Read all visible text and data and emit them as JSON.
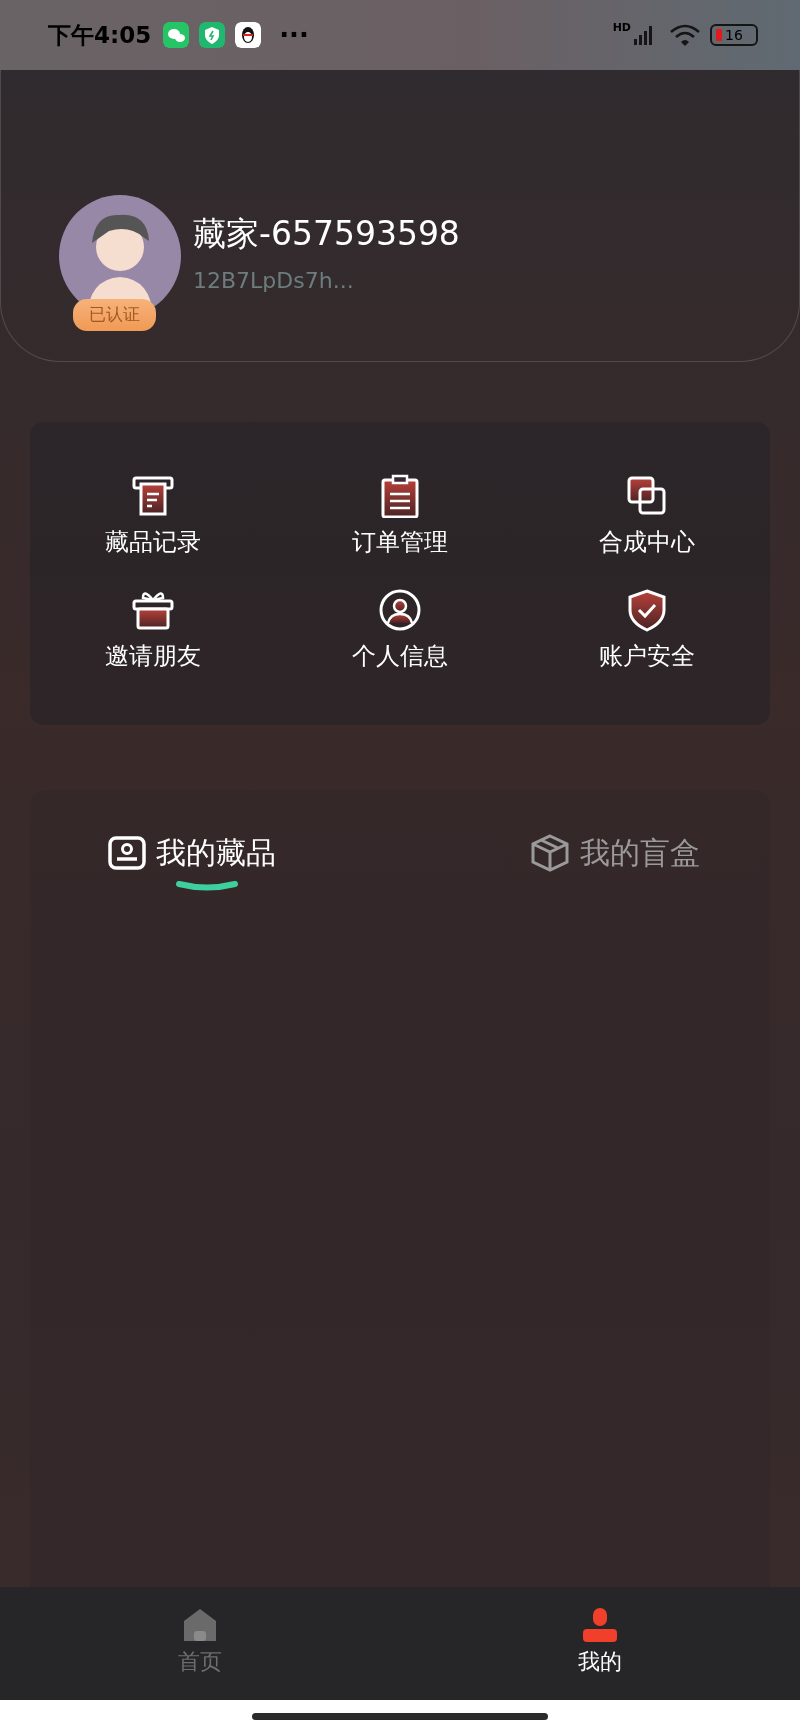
{
  "status_bar": {
    "time": "下午4:05",
    "notifications": [
      {
        "kind": "chat"
      },
      {
        "kind": "shield"
      },
      {
        "kind": "penguin"
      }
    ],
    "more": "···",
    "network_label": "HD",
    "battery": "16"
  },
  "profile": {
    "name": "藏家-657593598",
    "address": "12B7LpDs7h...",
    "badge": "已认证"
  },
  "menu": [
    {
      "label": "藏品记录",
      "kind": "receipt"
    },
    {
      "label": "订单管理",
      "kind": "clipboard"
    },
    {
      "label": "合成中心",
      "kind": "squares"
    },
    {
      "label": "邀请朋友",
      "kind": "gift"
    },
    {
      "label": "个人信息",
      "kind": "person"
    },
    {
      "label": "账户安全",
      "kind": "shield"
    }
  ],
  "tabs": [
    {
      "label": "我的藏品",
      "kind": "card",
      "selected": true
    },
    {
      "label": "我的盲盒",
      "kind": "box",
      "selected": false
    }
  ],
  "bottom_nav": [
    {
      "label": "首页",
      "kind": "home",
      "selected": false
    },
    {
      "label": "我的",
      "kind": "user",
      "selected": true
    }
  ]
}
